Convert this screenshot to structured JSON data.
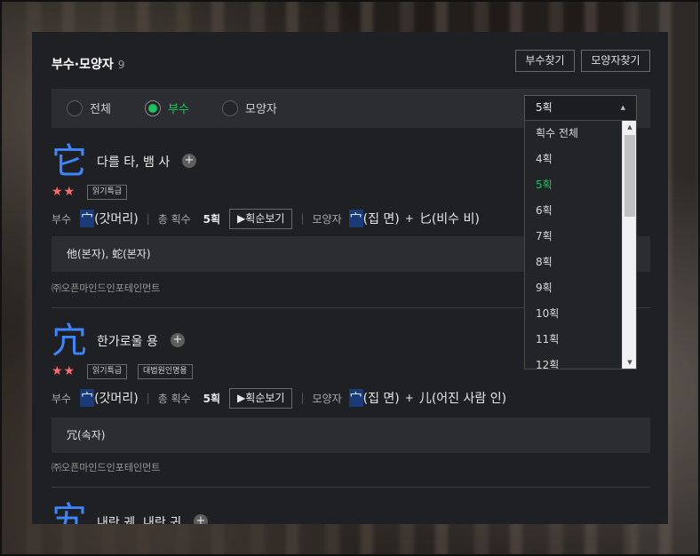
{
  "header": {
    "title": "부수·모양자",
    "count": "9"
  },
  "buttons": {
    "find_radical": "부수찾기",
    "find_shape": "모양자찾기"
  },
  "filter": {
    "options": [
      "전체",
      "부수",
      "모양자"
    ],
    "selected": "부수"
  },
  "stroke_select": {
    "value": "5획",
    "options": [
      "획수 전체",
      "4획",
      "5획",
      "6획",
      "7획",
      "8획",
      "9획",
      "10획",
      "11획",
      "12획"
    ],
    "selected": "5획"
  },
  "labels": {
    "radical": "부수",
    "total_strokes": "총 획수",
    "stroke_order_btn": "획순보기",
    "shape": "모양자",
    "plus": "+"
  },
  "entries": [
    {
      "hanja": "它",
      "meaning": "다를 타, 뱀 사",
      "stars": "★★",
      "tags": [
        "읽기특급"
      ],
      "radical_char": "宀",
      "radical_name": "(갓머리)",
      "strokes": "5획",
      "shape1_char": "宀",
      "shape1_name": "(집 면)",
      "shape2_char": "匕",
      "shape2_name": "(비수 비)",
      "related": "他(본자), 蛇(본자)",
      "source": "㈜오픈마인드인포테인먼트"
    },
    {
      "hanja": "宂",
      "meaning": "한가로울 용",
      "stars": "★★",
      "tags": [
        "읽기특급",
        "대법원인명용"
      ],
      "radical_char": "宀",
      "radical_name": "(갓머리)",
      "strokes": "5획",
      "shape1_char": "宀",
      "shape1_name": "(집 면)",
      "shape2_char": "儿",
      "shape2_name": "(어진 사람 인)",
      "related": "冗(속자)",
      "source": "㈜오픈마인드인포테인먼트"
    },
    {
      "hanja": "宄",
      "meaning": "내란 궤, 내란 귀"
    }
  ],
  "colors": {
    "accent_green": "#1bc55d",
    "hanja_blue": "#3d86ff",
    "star_red": "#ff6b6b"
  }
}
